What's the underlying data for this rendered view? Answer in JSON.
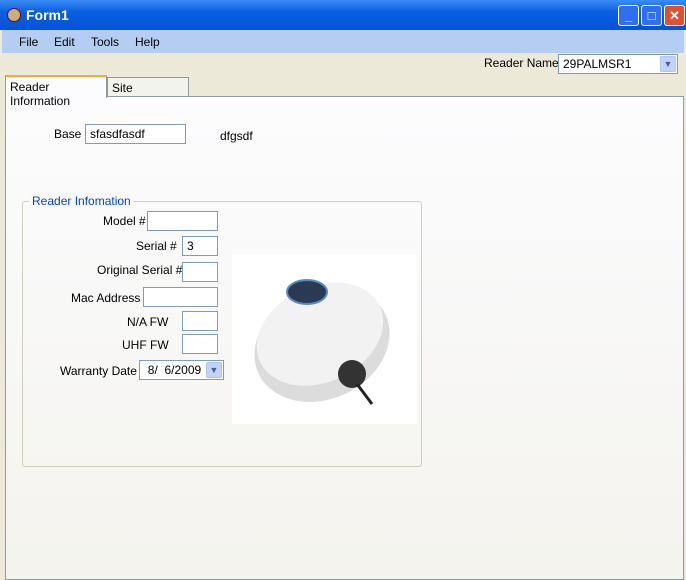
{
  "window": {
    "title": "Form1"
  },
  "menu": [
    "File",
    "Edit",
    "Tools",
    "Help"
  ],
  "reader_name": {
    "label": "Reader Name",
    "value": "29PALMSR1"
  },
  "tabs": [
    {
      "label": "Reader Information"
    },
    {
      "label": "Site Information"
    }
  ],
  "base": {
    "label": "Base",
    "value": "sfasdfasdf",
    "extra": "dfgsdf"
  },
  "group": {
    "title": "Reader Infomation",
    "fields": {
      "model": {
        "label": "Model #",
        "value": ""
      },
      "serial": {
        "label": "Serial #",
        "value": "3"
      },
      "orig_serial": {
        "label": "Original Serial #",
        "value": ""
      },
      "mac": {
        "label": "Mac Address",
        "value": ""
      },
      "na_fw": {
        "label": "N/A FW",
        "value": ""
      },
      "uhf_fw": {
        "label": "UHF FW",
        "value": ""
      },
      "warranty": {
        "label": "Warranty Date",
        "value": "8/  6/2009"
      }
    }
  }
}
